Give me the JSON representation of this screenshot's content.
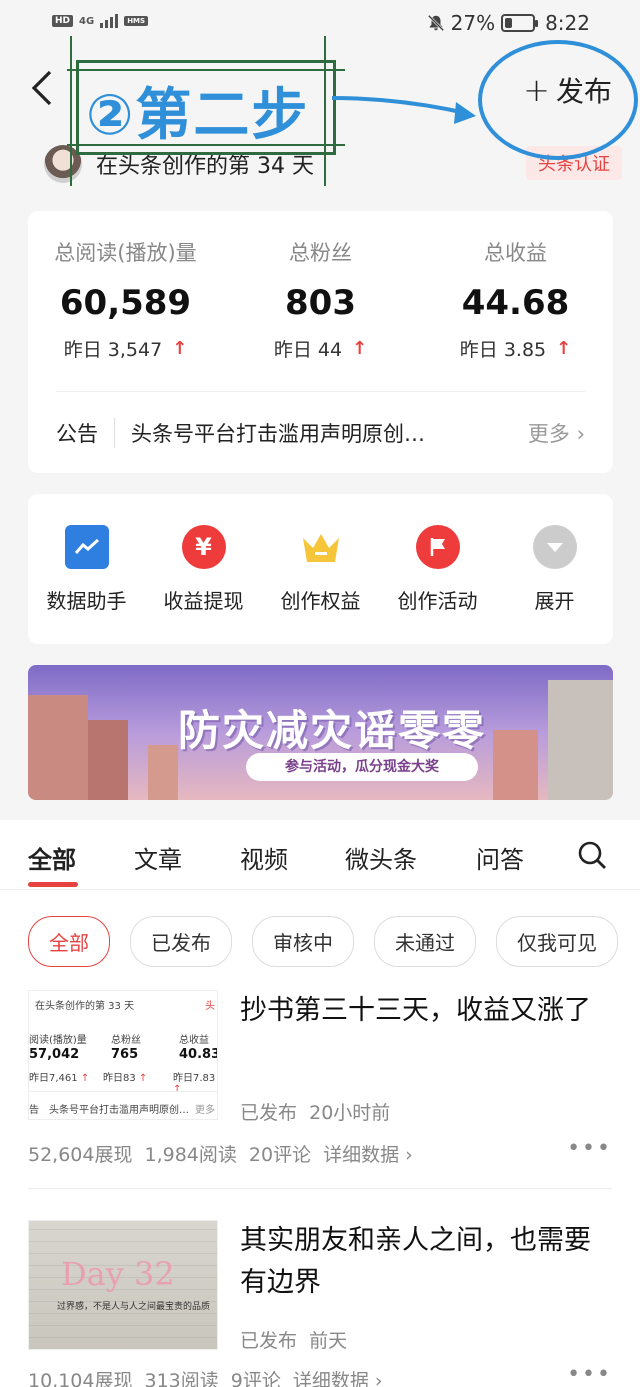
{
  "status_bar": {
    "chips": [
      "HD",
      "4G",
      "HMS"
    ],
    "battery_percent": "27%",
    "battery_level": 0.27,
    "time": "8:22"
  },
  "header": {
    "publish_icon": "plus-icon",
    "publish_label": "发布",
    "subtitle": "在头条创作的第 34 天",
    "cert_badge": "头条认证"
  },
  "annotation": {
    "text": "②第二步",
    "color": "#2f8fd8"
  },
  "stats": [
    {
      "label": "总阅读(播放)量",
      "value": "60,589",
      "yesterday_label": "昨日",
      "yesterday_value": "3,547"
    },
    {
      "label": "总粉丝",
      "value": "803",
      "yesterday_label": "昨日",
      "yesterday_value": "44"
    },
    {
      "label": "总收益",
      "value": "44.68",
      "yesterday_label": "昨日",
      "yesterday_value": "3.85"
    }
  ],
  "notice": {
    "tag": "公告",
    "text": "头条号平台打击滥用声明原创…",
    "more": "更多"
  },
  "tools": [
    {
      "label": "数据助手",
      "icon": "chart-icon",
      "color": "#2f7fe0"
    },
    {
      "label": "收益提现",
      "icon": "yuan-icon",
      "color": "#ee3b3b"
    },
    {
      "label": "创作权益",
      "icon": "crown-icon",
      "color": "#f6c53a"
    },
    {
      "label": "创作活动",
      "icon": "flag-icon",
      "color": "#ee3b3b"
    },
    {
      "label": "展开",
      "icon": "chevron-down-icon",
      "color": "#cccccc"
    }
  ],
  "banner": {
    "title": "防灾减灾谣零零",
    "cta": "参与活动，瓜分现金大奖"
  },
  "tabs": [
    {
      "label": "全部",
      "active": true
    },
    {
      "label": "文章",
      "active": false
    },
    {
      "label": "视频",
      "active": false
    },
    {
      "label": "微头条",
      "active": false
    },
    {
      "label": "问答",
      "active": false
    }
  ],
  "filters": [
    {
      "label": "全部",
      "active": true
    },
    {
      "label": "已发布",
      "active": false
    },
    {
      "label": "审核中",
      "active": false
    },
    {
      "label": "未通过",
      "active": false
    },
    {
      "label": "仅我可见",
      "active": false
    }
  ],
  "articles": [
    {
      "title": "抄书第三十三天，收益又涨了",
      "status": "已发布",
      "time": "20小时前",
      "impressions": "52,604展现",
      "reads": "1,984阅读",
      "comments": "20评论",
      "detail": "详细数据",
      "thumb": {
        "heading": "在头条创作的第 33 天",
        "badge": "头",
        "labels": [
          "阅读(播放)量",
          "总粉丝",
          "总收益"
        ],
        "values": [
          "57,042",
          "765",
          "40.83"
        ],
        "deltas": [
          "7,461",
          "83",
          "7.83"
        ],
        "yesterday": "昨日",
        "notice_tag": "告",
        "notice": "头条号平台打击滥用声明原创…",
        "more": "更多"
      }
    },
    {
      "title": "其实朋友和亲人之间，也需要有边界",
      "status": "已发布",
      "time": "前天",
      "impressions": "10,104展现",
      "reads": "313阅读",
      "comments": "9评论",
      "detail": "详细数据",
      "thumb": {
        "heading": "Day 32",
        "caption": "过界感，不是人与人之间最宝贵的品质"
      }
    }
  ]
}
